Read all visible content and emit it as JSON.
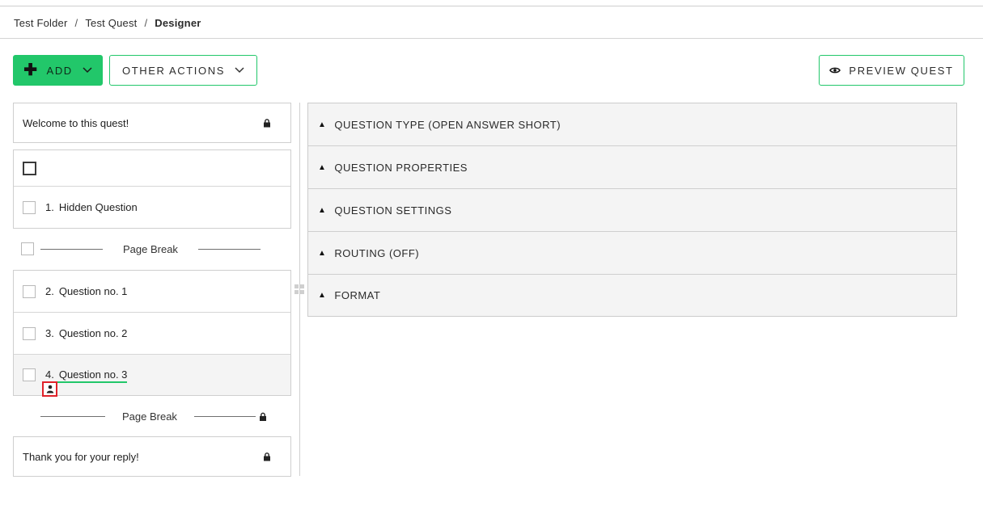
{
  "breadcrumb": {
    "items": [
      "Test Folder",
      "Test Quest",
      "Designer"
    ],
    "separator": "/"
  },
  "toolbar": {
    "add_label": "ADD",
    "other_actions_label": "OTHER ACTIONS",
    "preview_label": "PREVIEW QUEST"
  },
  "colors": {
    "accent": "#22c76a",
    "highlight_border": "#e0222a"
  },
  "outline": {
    "welcome": "Welcome to this quest!",
    "thanks": "Thank you for your reply!",
    "page_break_label": "Page Break",
    "questions": [
      {
        "number": "1.",
        "title": "Hidden Question"
      },
      {
        "number": "2.",
        "title": "Question no. 1"
      },
      {
        "number": "3.",
        "title": "Question no. 2"
      },
      {
        "number": "4.",
        "title": "Question no. 3"
      }
    ]
  },
  "panel": {
    "sections": [
      "QUESTION TYPE (OPEN ANSWER SHORT)",
      "QUESTION PROPERTIES",
      "QUESTION SETTINGS",
      "ROUTING (OFF)",
      "FORMAT"
    ]
  }
}
